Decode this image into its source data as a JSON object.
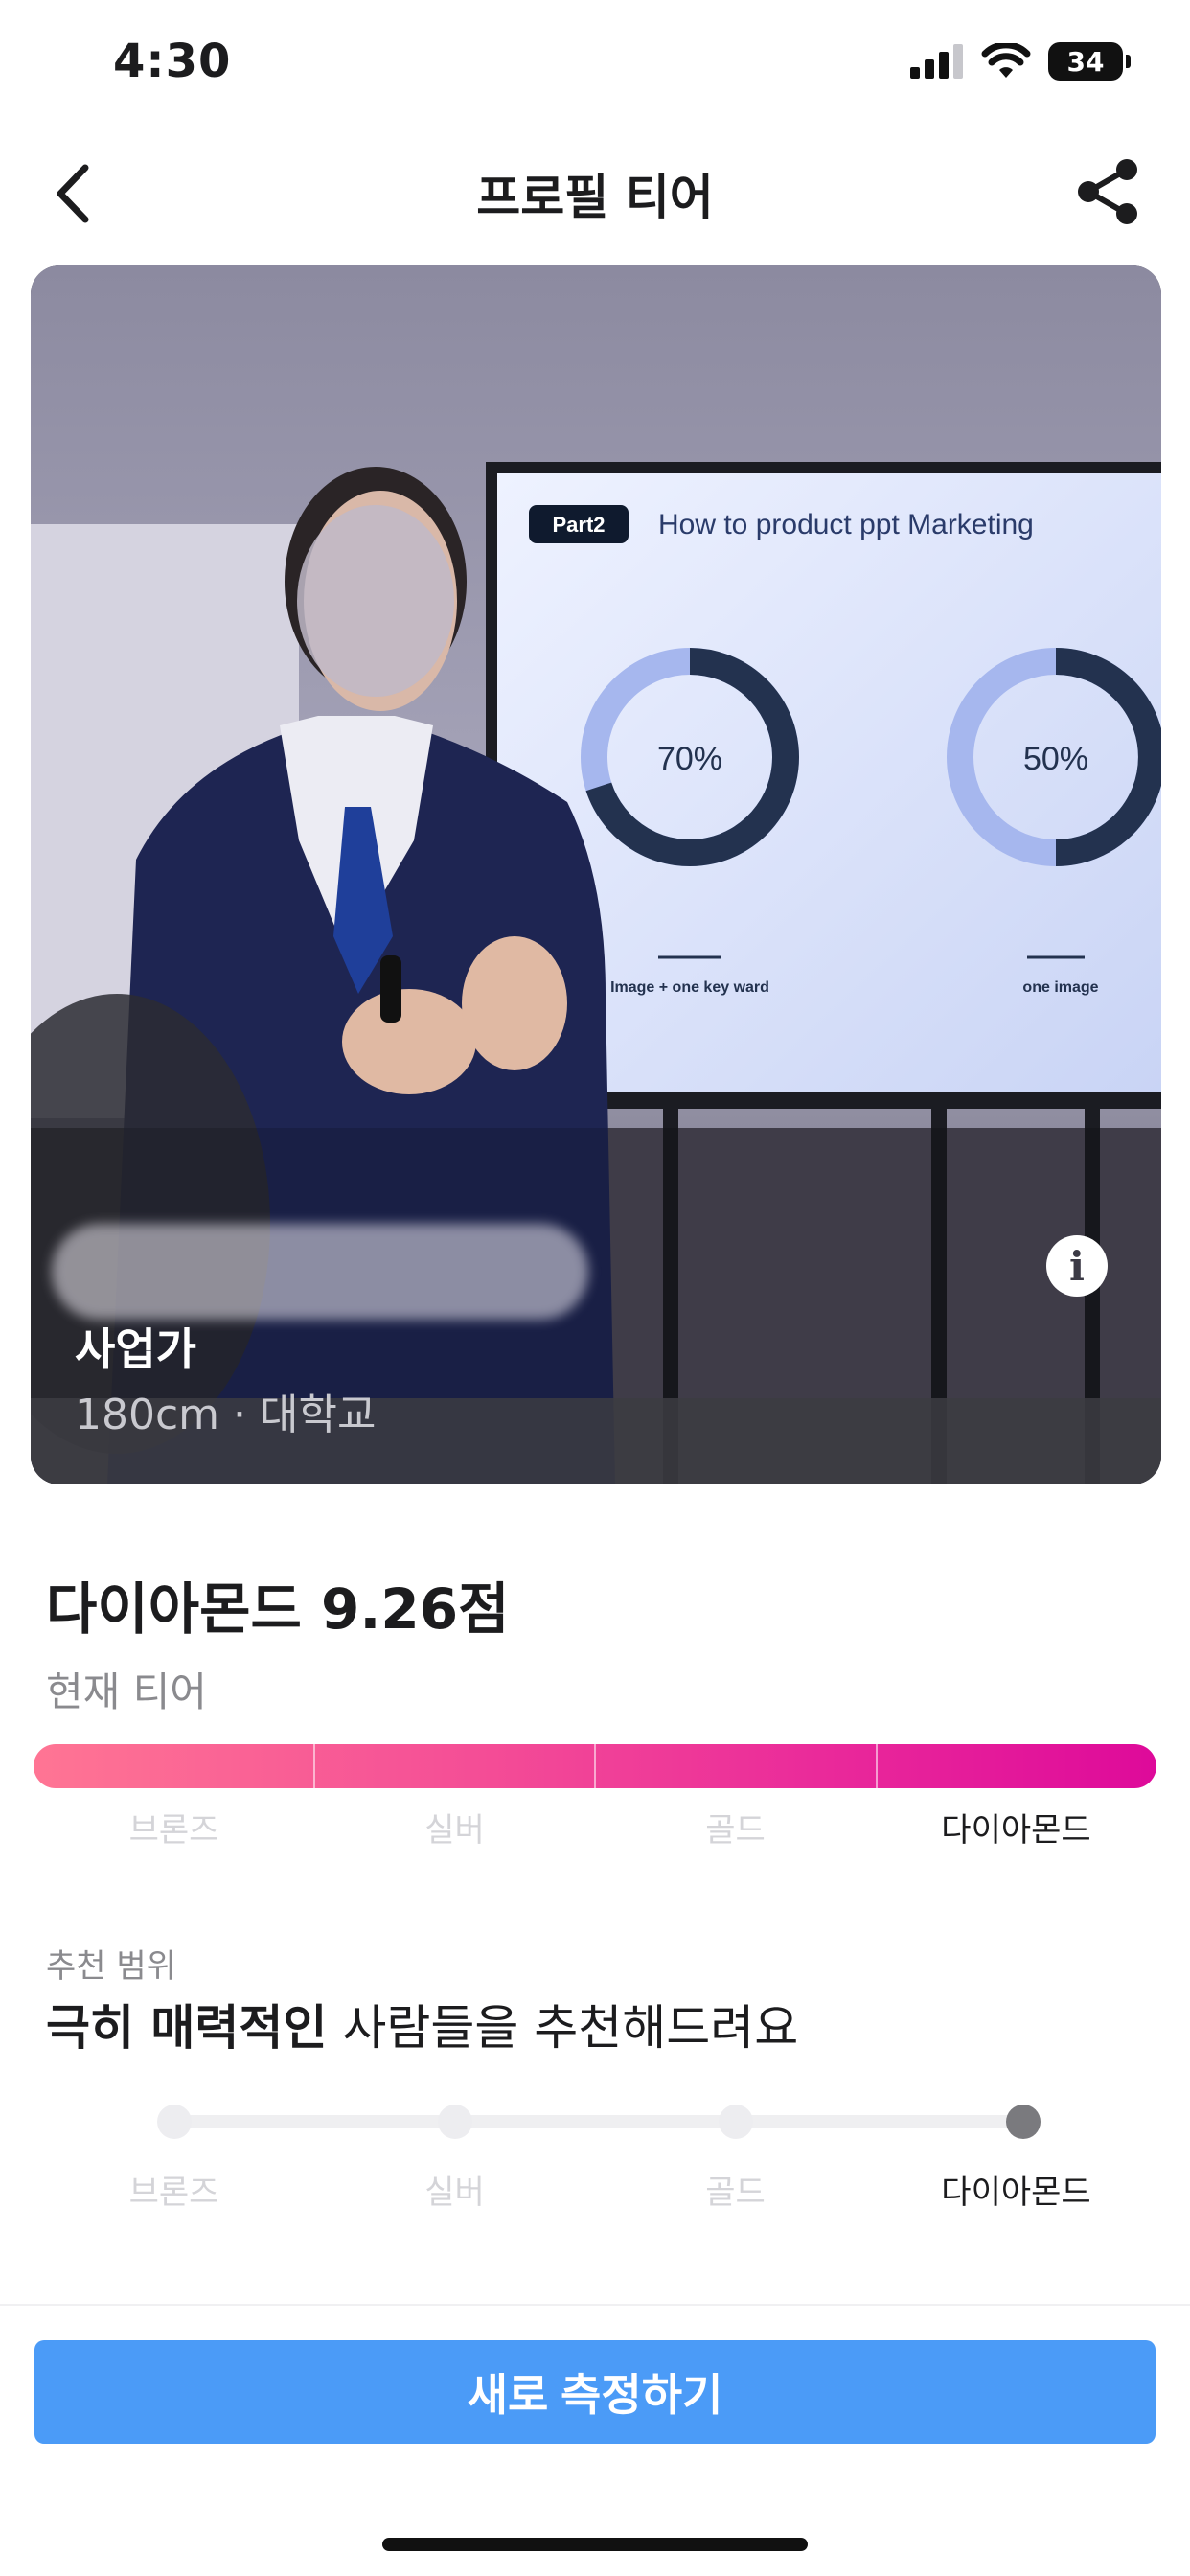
{
  "status_bar": {
    "time": "4:30",
    "battery": "34"
  },
  "nav": {
    "title": "프로필 티어",
    "back_icon": "chevron-left-icon",
    "share_icon": "share-icon"
  },
  "profile_card": {
    "occupation": "사업가",
    "details": "180cm · 대학교",
    "slide": {
      "tag": "Part2",
      "heading": "How to product ppt Marketing",
      "charts": [
        {
          "value": 0.7,
          "label": "70%",
          "caption": "Image + one key ward"
        },
        {
          "value": 0.5,
          "label": "50%",
          "caption": "one image"
        }
      ]
    },
    "info_icon": "info-icon"
  },
  "score": {
    "title": "다이아몬드 9.26점",
    "subtitle": "현재 티어"
  },
  "tiers": [
    "브론즈",
    "실버",
    "골드",
    "다이아몬드"
  ],
  "current_tier_index": 3,
  "recommendation": {
    "label": "추천 범위",
    "emphasis": "극히 매력적인",
    "rest": " 사람들을 추천해드려요",
    "selected_tier_index": 3
  },
  "cta": {
    "label": "새로 측정하기"
  },
  "colors": {
    "accent_blue": "#4b9bf7",
    "tier_gradient_start": "#ff7594",
    "tier_gradient_end": "#de0a9a"
  }
}
